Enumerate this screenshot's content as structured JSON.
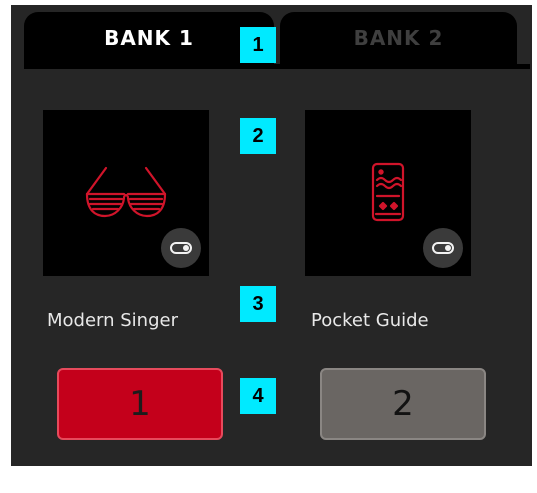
{
  "tabs": [
    {
      "label": "BANK 1",
      "active": true
    },
    {
      "label": "BANK 2",
      "active": false
    }
  ],
  "presets": [
    {
      "name": "Modern Singer",
      "icon": "shutter-glasses-icon",
      "slot": "1",
      "selected": true
    },
    {
      "name": "Pocket Guide",
      "icon": "phone-cards-icon",
      "slot": "2",
      "selected": false
    }
  ],
  "callouts": [
    "1",
    "2",
    "3",
    "4"
  ],
  "colors": {
    "accent": "#c4001b",
    "icon_red": "#d0142a",
    "panel": "#262626",
    "callout": "#00eaff"
  }
}
